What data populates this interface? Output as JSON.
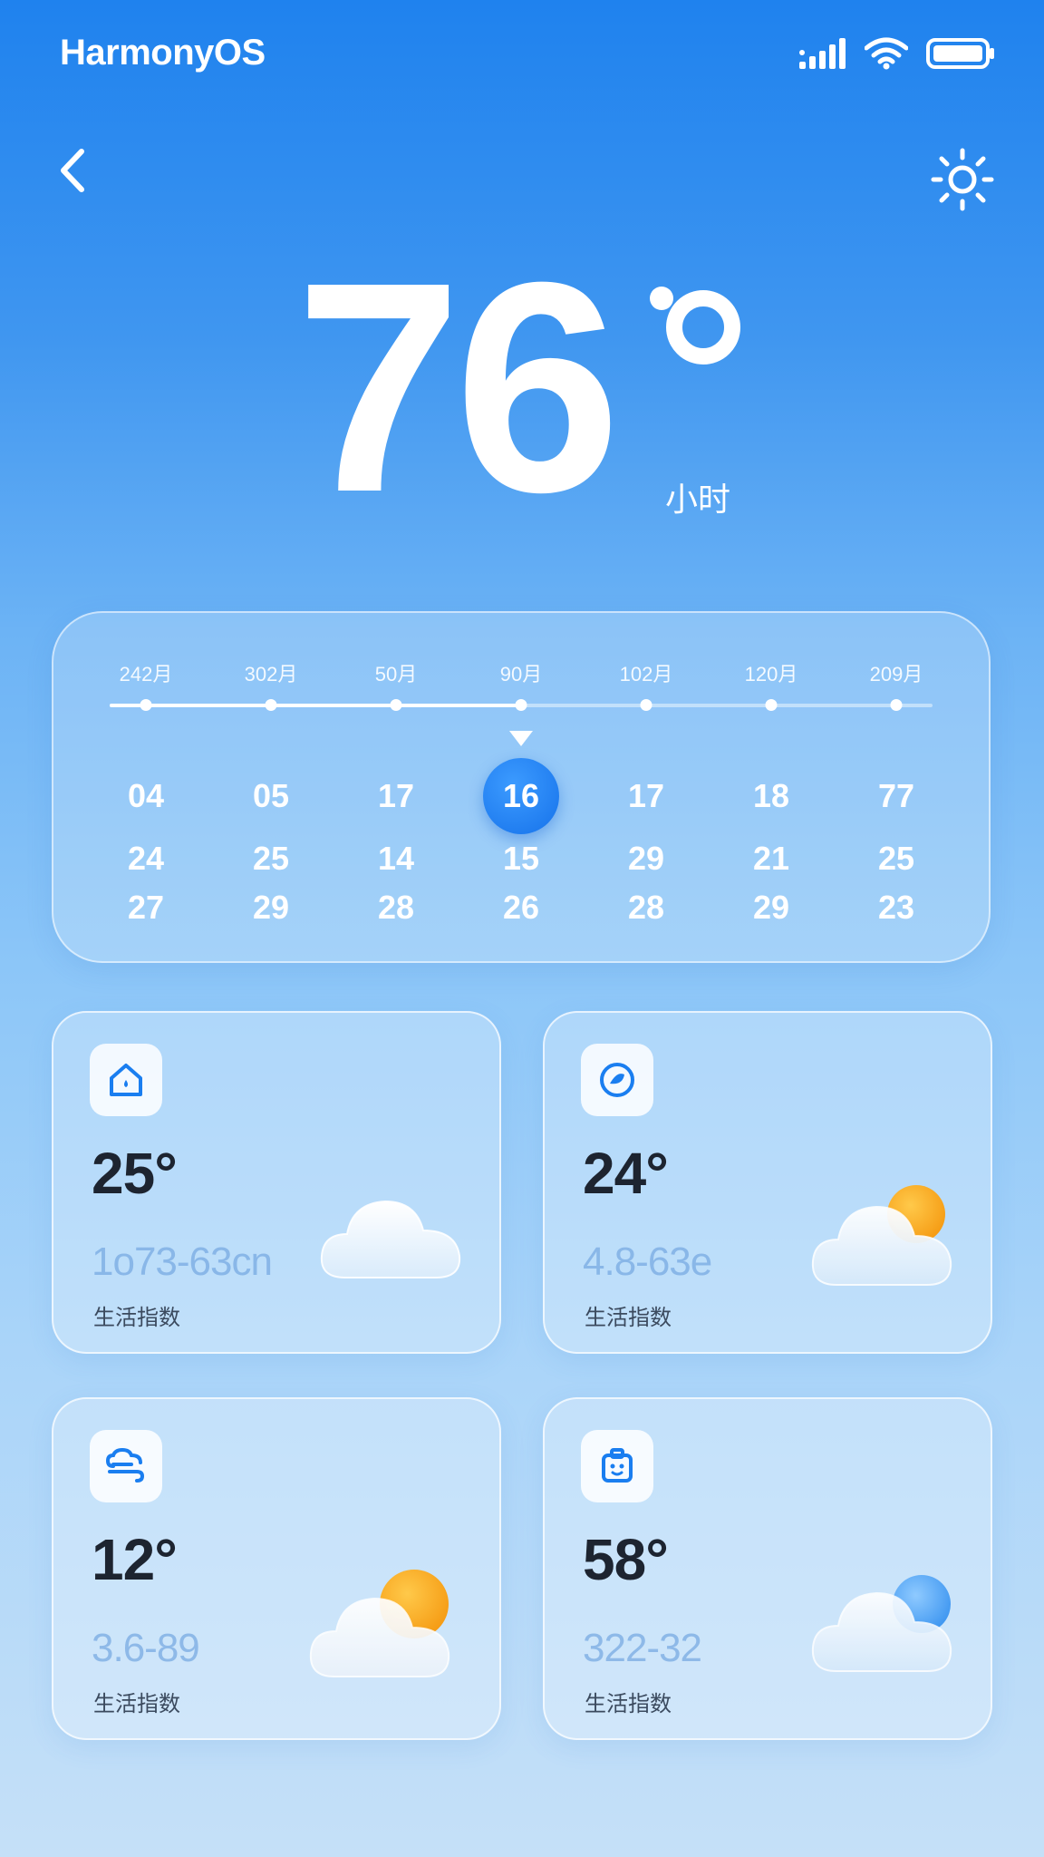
{
  "status_bar": {
    "brand": "HarmonyOS",
    "icons": [
      "signal-icon",
      "wifi-icon",
      "battery-icon"
    ]
  },
  "top_bar": {
    "back_icon": "back-chevron-icon",
    "action_icon": "sun-icon"
  },
  "hero": {
    "temperature": "76",
    "unit_label": "小时"
  },
  "calendar": {
    "months": [
      "242月",
      "302月",
      "50月",
      "90月",
      "102月",
      "120月",
      "209月"
    ],
    "progress_index": 3,
    "selected_index": 3,
    "days": [
      {
        "main": "04",
        "sub1": "24",
        "sub2": "27"
      },
      {
        "main": "05",
        "sub1": "25",
        "sub2": "29"
      },
      {
        "main": "17",
        "sub1": "14",
        "sub2": "28"
      },
      {
        "main": "16",
        "sub1": "15",
        "sub2": "26"
      },
      {
        "main": "17",
        "sub1": "29",
        "sub2": "28"
      },
      {
        "main": "18",
        "sub1": "21",
        "sub2": "29"
      },
      {
        "main": "77",
        "sub1": "25",
        "sub2": "23"
      }
    ]
  },
  "cards": [
    {
      "icon": "home-icon",
      "temp": "25°",
      "range": "1o73-63cn",
      "label": "生活指数",
      "art": "cloud"
    },
    {
      "icon": "leaf-badge-icon",
      "temp": "24°",
      "range": "4.8-63e",
      "label": "生活指数",
      "art": "partly-sunny"
    },
    {
      "icon": "wind-cloud-icon",
      "temp": "12°",
      "range": "3.6-89",
      "label": "生活指数",
      "art": "partly-sunny"
    },
    {
      "icon": "bag-icon",
      "temp": "58°",
      "range": "322-32",
      "label": "生活指数",
      "art": "cloud-blue"
    }
  ],
  "colors": {
    "accent": "#1672ea",
    "sun": "#f7a51c",
    "card_text": "#1d2430",
    "range_text": "#78aae1"
  }
}
